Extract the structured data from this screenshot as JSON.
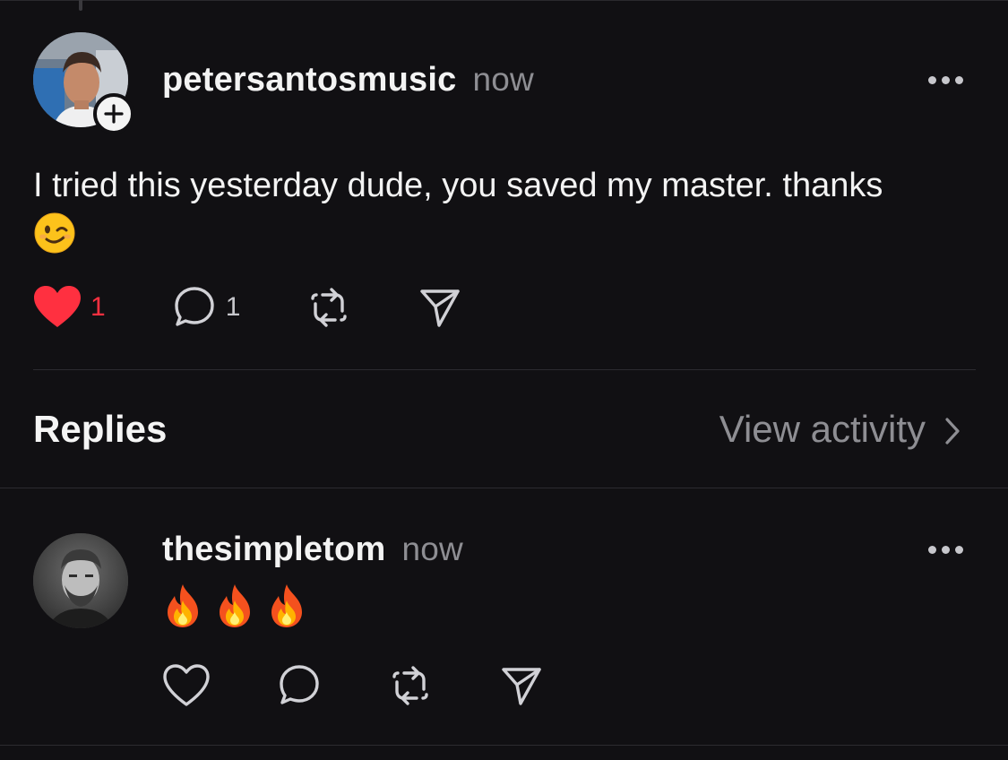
{
  "post": {
    "username": "petersantosmusic",
    "timestamp": "now",
    "text": "I tried this yesterday dude, you saved my master. thanks",
    "emoji_icon": "winking-face-emoji",
    "likes": "1",
    "comments": "1",
    "liked": true
  },
  "replies_section": {
    "title": "Replies",
    "view_activity_label": "View activity"
  },
  "reply": {
    "username": "thesimpletom",
    "timestamp": "now",
    "emoji_icons": [
      "fire-emoji",
      "fire-emoji",
      "fire-emoji"
    ]
  },
  "colors": {
    "background": "#111013",
    "like_red": "#ff3040",
    "muted": "#8e8e93"
  }
}
